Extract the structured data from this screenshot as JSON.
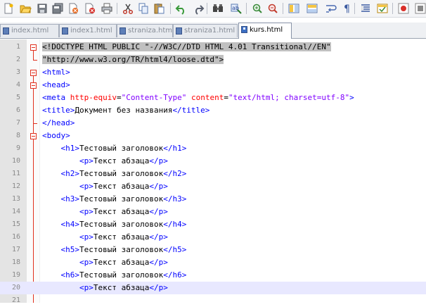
{
  "toolbar": {
    "icons": [
      "new-file-icon",
      "open-file-icon",
      "save-icon",
      "save-all-icon",
      "close-icon",
      "close-all-icon",
      "print-icon",
      "cut-icon",
      "copy-icon",
      "paste-icon",
      "undo-icon",
      "redo-icon",
      "find-icon",
      "replace-icon",
      "zoom-in-icon",
      "zoom-out-icon",
      "sync-vertical-icon",
      "sync-horizontal-icon",
      "word-wrap-icon",
      "show-all-chars-icon",
      "indent-guide-icon",
      "user-lang-icon",
      "record-macro-icon",
      "stop-macro-icon"
    ]
  },
  "tabs": [
    {
      "label": "index.html",
      "active": false
    },
    {
      "label": "index1.html",
      "active": false
    },
    {
      "label": "straniza.html",
      "active": false
    },
    {
      "label": "straniza1.html",
      "active": false
    },
    {
      "label": "kurs.html",
      "active": true
    }
  ],
  "editor": {
    "line_numbers": [
      "1",
      "2",
      "3",
      "4",
      "5",
      "6",
      "7",
      "8",
      "9",
      "10",
      "11",
      "12",
      "13",
      "14",
      "15",
      "16",
      "17",
      "18",
      "19",
      "20",
      "21"
    ],
    "current_line": 20,
    "lines": [
      [
        {
          "t": "sel",
          "s": "<!DOCTYPE HTML PUBLIC \"-//W3C//DTD HTML 4.01 Transitional//EN\""
        }
      ],
      [
        {
          "t": "sel",
          "s": "\"http://www.w3.org/TR/html4/loose.dtd\">"
        }
      ],
      [
        {
          "t": "tag",
          "s": "<html>"
        }
      ],
      [
        {
          "t": "tag",
          "s": "<head>"
        }
      ],
      [
        {
          "t": "tag",
          "s": "<meta "
        },
        {
          "t": "attr",
          "s": "http-equiv"
        },
        {
          "t": "txt",
          "s": "="
        },
        {
          "t": "val",
          "s": "\"Content-Type\""
        },
        {
          "t": "txt",
          "s": " "
        },
        {
          "t": "attr",
          "s": "content"
        },
        {
          "t": "txt",
          "s": "="
        },
        {
          "t": "val",
          "s": "\"text/html; charset=utf-8\""
        },
        {
          "t": "tag",
          "s": ">"
        }
      ],
      [
        {
          "t": "tag",
          "s": "<title>"
        },
        {
          "t": "txt",
          "s": "Документ без названия"
        },
        {
          "t": "tag",
          "s": "</title>"
        }
      ],
      [
        {
          "t": "tag",
          "s": "</head>"
        }
      ],
      [
        {
          "t": "tag",
          "s": "<body>"
        }
      ],
      [
        {
          "t": "txt",
          "s": "    "
        },
        {
          "t": "tag",
          "s": "<h1>"
        },
        {
          "t": "txt",
          "s": "Тестовый заголовок"
        },
        {
          "t": "tag",
          "s": "</h1>"
        }
      ],
      [
        {
          "t": "txt",
          "s": "        "
        },
        {
          "t": "tag",
          "s": "<p>"
        },
        {
          "t": "txt",
          "s": "Текст абзаца"
        },
        {
          "t": "tag",
          "s": "</p>"
        }
      ],
      [
        {
          "t": "txt",
          "s": "    "
        },
        {
          "t": "tag",
          "s": "<h2>"
        },
        {
          "t": "txt",
          "s": "Тестовый заголовок"
        },
        {
          "t": "tag",
          "s": "</h2>"
        }
      ],
      [
        {
          "t": "txt",
          "s": "        "
        },
        {
          "t": "tag",
          "s": "<p>"
        },
        {
          "t": "txt",
          "s": "Текст абзаца"
        },
        {
          "t": "tag",
          "s": "</p>"
        }
      ],
      [
        {
          "t": "txt",
          "s": "    "
        },
        {
          "t": "tag",
          "s": "<h3>"
        },
        {
          "t": "txt",
          "s": "Тестовый заголовок"
        },
        {
          "t": "tag",
          "s": "</h3>"
        }
      ],
      [
        {
          "t": "txt",
          "s": "        "
        },
        {
          "t": "tag",
          "s": "<p>"
        },
        {
          "t": "txt",
          "s": "Текст абзаца"
        },
        {
          "t": "tag",
          "s": "</p>"
        }
      ],
      [
        {
          "t": "txt",
          "s": "    "
        },
        {
          "t": "tag",
          "s": "<h4>"
        },
        {
          "t": "txt",
          "s": "Тестовый заголовок"
        },
        {
          "t": "tag",
          "s": "</h4>"
        }
      ],
      [
        {
          "t": "txt",
          "s": "        "
        },
        {
          "t": "tag",
          "s": "<p>"
        },
        {
          "t": "txt",
          "s": "Текст абзаца"
        },
        {
          "t": "tag",
          "s": "</p>"
        }
      ],
      [
        {
          "t": "txt",
          "s": "    "
        },
        {
          "t": "tag",
          "s": "<h5>"
        },
        {
          "t": "txt",
          "s": "Тестовый заголовок"
        },
        {
          "t": "tag",
          "s": "</h5>"
        }
      ],
      [
        {
          "t": "txt",
          "s": "        "
        },
        {
          "t": "tag",
          "s": "<p>"
        },
        {
          "t": "txt",
          "s": "Текст абзаца"
        },
        {
          "t": "tag",
          "s": "</p>"
        }
      ],
      [
        {
          "t": "txt",
          "s": "    "
        },
        {
          "t": "tag",
          "s": "<h6>"
        },
        {
          "t": "txt",
          "s": "Тестовый заголовок"
        },
        {
          "t": "tag",
          "s": "</h6>"
        }
      ],
      [
        {
          "t": "txt",
          "s": "        "
        },
        {
          "t": "tag",
          "s": "<p>"
        },
        {
          "t": "txt",
          "s": "Текст абзаца"
        },
        {
          "t": "tag",
          "s": "</p>"
        }
      ],
      []
    ]
  },
  "colors": {
    "tag": "#0000ff",
    "attribute": "#ff0000",
    "attribute_value": "#8000ff",
    "text": "#000000",
    "selection": "#c0c0c0",
    "current_line": "#e8e8ff",
    "fold_marker": "#e0301e"
  }
}
